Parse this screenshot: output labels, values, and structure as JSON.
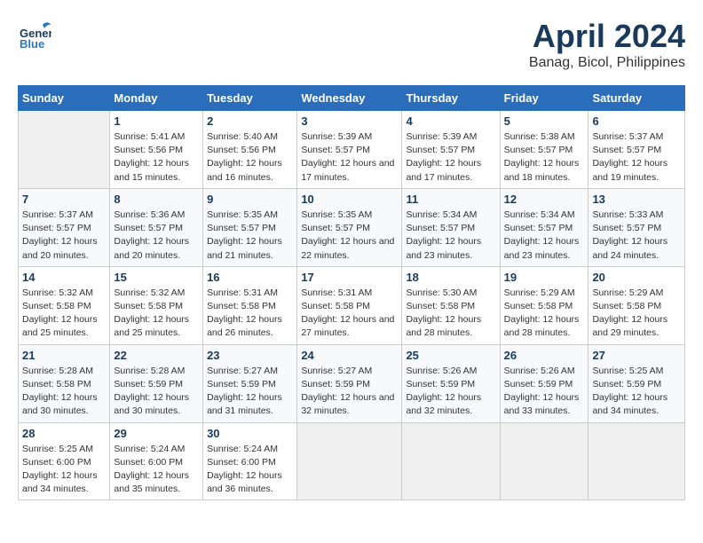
{
  "header": {
    "logo_general": "General",
    "logo_blue": "Blue",
    "title": "April 2024",
    "subtitle": "Banag, Bicol, Philippines"
  },
  "calendar": {
    "columns": [
      "Sunday",
      "Monday",
      "Tuesday",
      "Wednesday",
      "Thursday",
      "Friday",
      "Saturday"
    ],
    "weeks": [
      [
        {
          "day": "",
          "sunrise": "",
          "sunset": "",
          "daylight": "",
          "empty": true
        },
        {
          "day": "1",
          "sunrise": "Sunrise: 5:41 AM",
          "sunset": "Sunset: 5:56 PM",
          "daylight": "Daylight: 12 hours and 15 minutes."
        },
        {
          "day": "2",
          "sunrise": "Sunrise: 5:40 AM",
          "sunset": "Sunset: 5:56 PM",
          "daylight": "Daylight: 12 hours and 16 minutes."
        },
        {
          "day": "3",
          "sunrise": "Sunrise: 5:39 AM",
          "sunset": "Sunset: 5:57 PM",
          "daylight": "Daylight: 12 hours and 17 minutes."
        },
        {
          "day": "4",
          "sunrise": "Sunrise: 5:39 AM",
          "sunset": "Sunset: 5:57 PM",
          "daylight": "Daylight: 12 hours and 17 minutes."
        },
        {
          "day": "5",
          "sunrise": "Sunrise: 5:38 AM",
          "sunset": "Sunset: 5:57 PM",
          "daylight": "Daylight: 12 hours and 18 minutes."
        },
        {
          "day": "6",
          "sunrise": "Sunrise: 5:37 AM",
          "sunset": "Sunset: 5:57 PM",
          "daylight": "Daylight: 12 hours and 19 minutes."
        }
      ],
      [
        {
          "day": "7",
          "sunrise": "Sunrise: 5:37 AM",
          "sunset": "Sunset: 5:57 PM",
          "daylight": "Daylight: 12 hours and 20 minutes."
        },
        {
          "day": "8",
          "sunrise": "Sunrise: 5:36 AM",
          "sunset": "Sunset: 5:57 PM",
          "daylight": "Daylight: 12 hours and 20 minutes."
        },
        {
          "day": "9",
          "sunrise": "Sunrise: 5:35 AM",
          "sunset": "Sunset: 5:57 PM",
          "daylight": "Daylight: 12 hours and 21 minutes."
        },
        {
          "day": "10",
          "sunrise": "Sunrise: 5:35 AM",
          "sunset": "Sunset: 5:57 PM",
          "daylight": "Daylight: 12 hours and 22 minutes."
        },
        {
          "day": "11",
          "sunrise": "Sunrise: 5:34 AM",
          "sunset": "Sunset: 5:57 PM",
          "daylight": "Daylight: 12 hours and 23 minutes."
        },
        {
          "day": "12",
          "sunrise": "Sunrise: 5:34 AM",
          "sunset": "Sunset: 5:57 PM",
          "daylight": "Daylight: 12 hours and 23 minutes."
        },
        {
          "day": "13",
          "sunrise": "Sunrise: 5:33 AM",
          "sunset": "Sunset: 5:57 PM",
          "daylight": "Daylight: 12 hours and 24 minutes."
        }
      ],
      [
        {
          "day": "14",
          "sunrise": "Sunrise: 5:32 AM",
          "sunset": "Sunset: 5:58 PM",
          "daylight": "Daylight: 12 hours and 25 minutes."
        },
        {
          "day": "15",
          "sunrise": "Sunrise: 5:32 AM",
          "sunset": "Sunset: 5:58 PM",
          "daylight": "Daylight: 12 hours and 25 minutes."
        },
        {
          "day": "16",
          "sunrise": "Sunrise: 5:31 AM",
          "sunset": "Sunset: 5:58 PM",
          "daylight": "Daylight: 12 hours and 26 minutes."
        },
        {
          "day": "17",
          "sunrise": "Sunrise: 5:31 AM",
          "sunset": "Sunset: 5:58 PM",
          "daylight": "Daylight: 12 hours and 27 minutes."
        },
        {
          "day": "18",
          "sunrise": "Sunrise: 5:30 AM",
          "sunset": "Sunset: 5:58 PM",
          "daylight": "Daylight: 12 hours and 28 minutes."
        },
        {
          "day": "19",
          "sunrise": "Sunrise: 5:29 AM",
          "sunset": "Sunset: 5:58 PM",
          "daylight": "Daylight: 12 hours and 28 minutes."
        },
        {
          "day": "20",
          "sunrise": "Sunrise: 5:29 AM",
          "sunset": "Sunset: 5:58 PM",
          "daylight": "Daylight: 12 hours and 29 minutes."
        }
      ],
      [
        {
          "day": "21",
          "sunrise": "Sunrise: 5:28 AM",
          "sunset": "Sunset: 5:58 PM",
          "daylight": "Daylight: 12 hours and 30 minutes."
        },
        {
          "day": "22",
          "sunrise": "Sunrise: 5:28 AM",
          "sunset": "Sunset: 5:59 PM",
          "daylight": "Daylight: 12 hours and 30 minutes."
        },
        {
          "day": "23",
          "sunrise": "Sunrise: 5:27 AM",
          "sunset": "Sunset: 5:59 PM",
          "daylight": "Daylight: 12 hours and 31 minutes."
        },
        {
          "day": "24",
          "sunrise": "Sunrise: 5:27 AM",
          "sunset": "Sunset: 5:59 PM",
          "daylight": "Daylight: 12 hours and 32 minutes."
        },
        {
          "day": "25",
          "sunrise": "Sunrise: 5:26 AM",
          "sunset": "Sunset: 5:59 PM",
          "daylight": "Daylight: 12 hours and 32 minutes."
        },
        {
          "day": "26",
          "sunrise": "Sunrise: 5:26 AM",
          "sunset": "Sunset: 5:59 PM",
          "daylight": "Daylight: 12 hours and 33 minutes."
        },
        {
          "day": "27",
          "sunrise": "Sunrise: 5:25 AM",
          "sunset": "Sunset: 5:59 PM",
          "daylight": "Daylight: 12 hours and 34 minutes."
        }
      ],
      [
        {
          "day": "28",
          "sunrise": "Sunrise: 5:25 AM",
          "sunset": "Sunset: 6:00 PM",
          "daylight": "Daylight: 12 hours and 34 minutes."
        },
        {
          "day": "29",
          "sunrise": "Sunrise: 5:24 AM",
          "sunset": "Sunset: 6:00 PM",
          "daylight": "Daylight: 12 hours and 35 minutes."
        },
        {
          "day": "30",
          "sunrise": "Sunrise: 5:24 AM",
          "sunset": "Sunset: 6:00 PM",
          "daylight": "Daylight: 12 hours and 36 minutes."
        },
        {
          "day": "",
          "sunrise": "",
          "sunset": "",
          "daylight": "",
          "empty": true
        },
        {
          "day": "",
          "sunrise": "",
          "sunset": "",
          "daylight": "",
          "empty": true
        },
        {
          "day": "",
          "sunrise": "",
          "sunset": "",
          "daylight": "",
          "empty": true
        },
        {
          "day": "",
          "sunrise": "",
          "sunset": "",
          "daylight": "",
          "empty": true
        }
      ]
    ]
  }
}
